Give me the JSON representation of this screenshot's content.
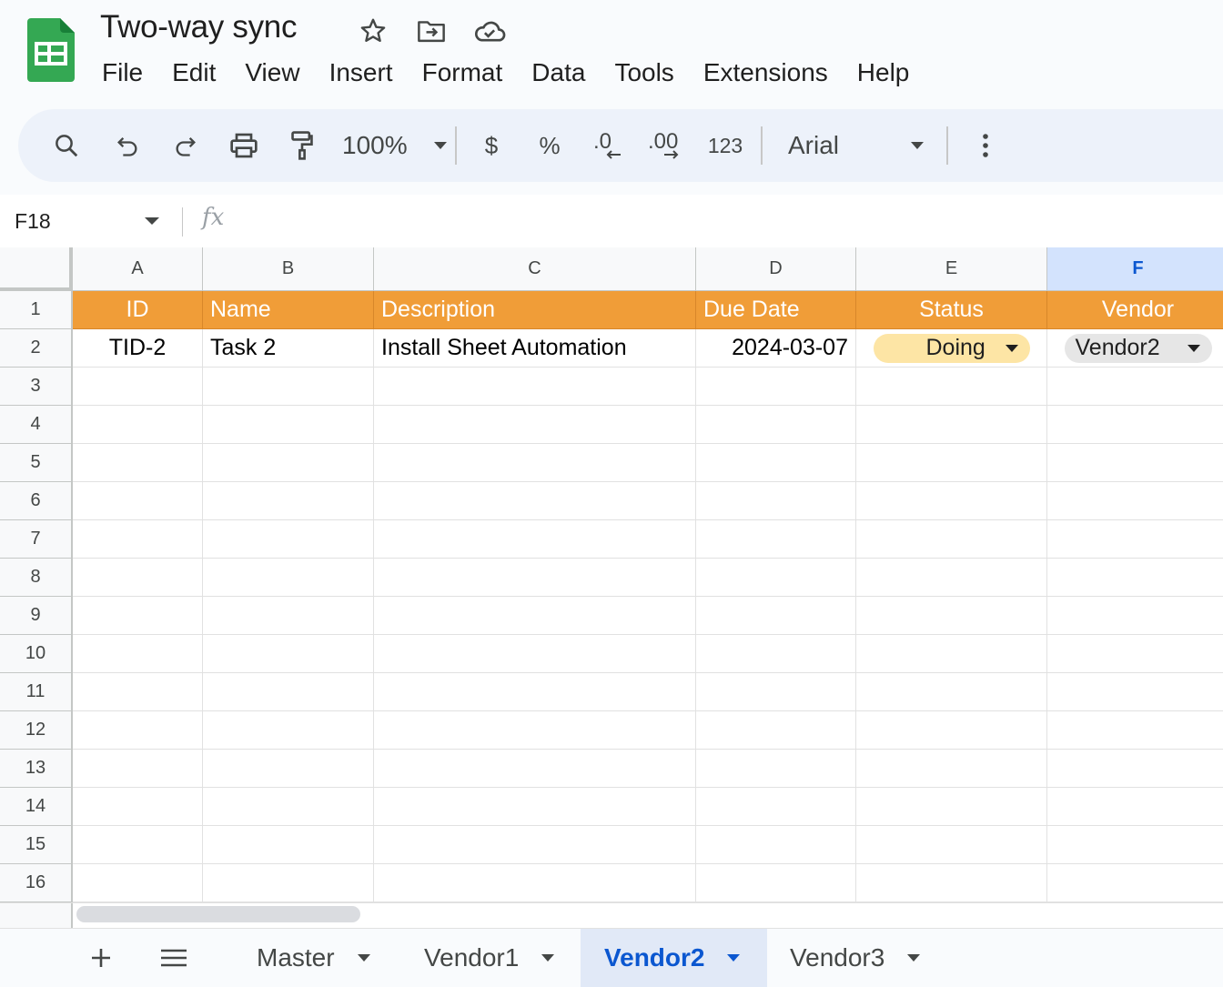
{
  "document": {
    "title": "Two-way sync"
  },
  "title_icons": [
    "star-icon",
    "move-to-folder-icon",
    "cloud-saved-icon"
  ],
  "menu": [
    "File",
    "Edit",
    "View",
    "Insert",
    "Format",
    "Data",
    "Tools",
    "Extensions",
    "Help"
  ],
  "toolbar": {
    "zoom": "100%",
    "currency": "$",
    "percent": "%",
    "number_format": "123",
    "font": "Arial"
  },
  "formula_bar": {
    "cell_ref": "F18",
    "fx_label": "fx",
    "value": ""
  },
  "columns": [
    "A",
    "B",
    "C",
    "D",
    "E",
    "F"
  ],
  "selected_column": "F",
  "rows": [
    "1",
    "2",
    "3",
    "4",
    "5",
    "6",
    "7",
    "8",
    "9",
    "10",
    "11",
    "12",
    "13",
    "14",
    "15",
    "16"
  ],
  "header_row": [
    "ID",
    "Name",
    "Description",
    "Due Date",
    "Status",
    "Vendor"
  ],
  "data_row": {
    "id": "TID-2",
    "name": "Task 2",
    "description": "Install Sheet Automation",
    "due_date": "2024-03-07",
    "status": "Doing",
    "vendor": "Vendor2"
  },
  "colors": {
    "header_fill": "#f09d38",
    "status_chip": "#fde5a5",
    "vendor_chip": "#e6e6e6",
    "accent": "#0b57d0"
  },
  "sheet_tabs": [
    "Master",
    "Vendor1",
    "Vendor2",
    "Vendor3"
  ],
  "active_tab": "Vendor2"
}
